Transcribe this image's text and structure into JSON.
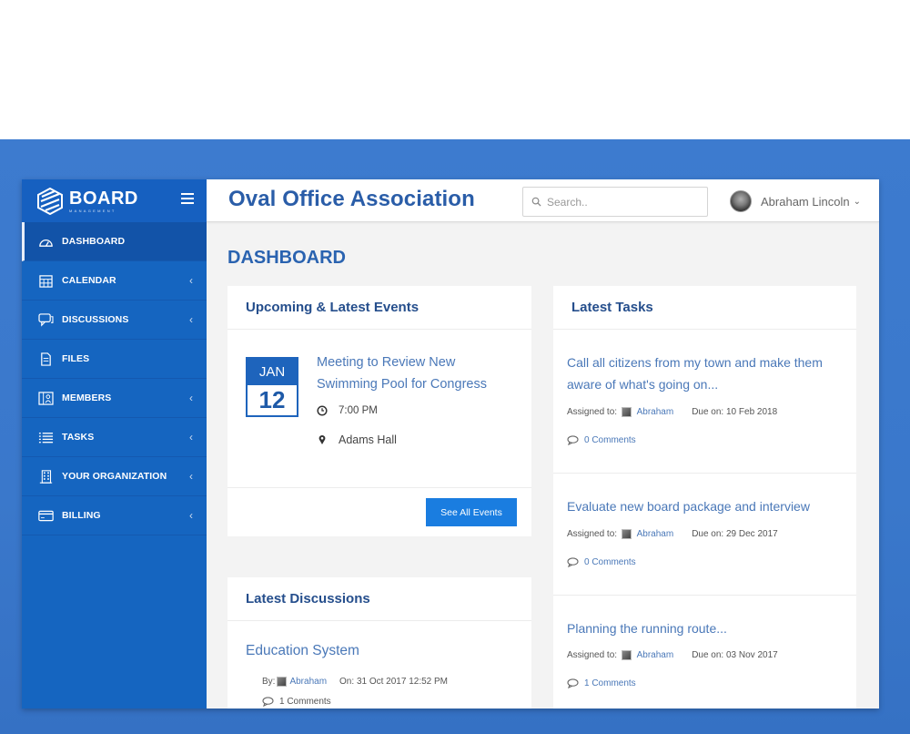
{
  "brand": {
    "name": "BOARD",
    "subtitle": "MANAGEMENT"
  },
  "sidebar": {
    "items": [
      {
        "label": "DASHBOARD",
        "icon": "dashboard-gauge-icon",
        "active": true,
        "has_submenu": false
      },
      {
        "label": "CALENDAR",
        "icon": "calendar-icon",
        "active": false,
        "has_submenu": true
      },
      {
        "label": "DISCUSSIONS",
        "icon": "chat-bubbles-icon",
        "active": false,
        "has_submenu": true
      },
      {
        "label": "FILES",
        "icon": "file-icon",
        "active": false,
        "has_submenu": false
      },
      {
        "label": "MEMBERS",
        "icon": "members-icon",
        "active": false,
        "has_submenu": true
      },
      {
        "label": "TASKS",
        "icon": "list-icon",
        "active": false,
        "has_submenu": true
      },
      {
        "label": "YOUR ORGANIZATION",
        "icon": "building-icon",
        "active": false,
        "has_submenu": true
      },
      {
        "label": "BILLING",
        "icon": "credit-card-icon",
        "active": false,
        "has_submenu": true
      }
    ],
    "chevron": "‹"
  },
  "header": {
    "org_title": "Oval Office Association",
    "search_placeholder": "Search..",
    "user_name": "Abraham Lincoln",
    "user_chevron": "⌄"
  },
  "page": {
    "title": "DASHBOARD"
  },
  "events": {
    "title": "Upcoming & Latest Events",
    "items": [
      {
        "month": "JAN",
        "day": "12",
        "title": "Meeting to Review New Swimming Pool for Congress",
        "time": "7:00 PM",
        "location": "Adams Hall"
      }
    ],
    "see_all_label": "See All Events"
  },
  "discussions": {
    "title": "Latest Discussions",
    "items": [
      {
        "title": "Education System",
        "by_label": "By:",
        "author": "Abraham",
        "on_label": "On:",
        "date": "31 Oct 2017 12:52 PM",
        "comments": "1 Comments"
      }
    ]
  },
  "tasks": {
    "title": "Latest Tasks",
    "assigned_label": "Assigned to:",
    "due_label": "Due on:",
    "items": [
      {
        "title": "Call all citizens from my town and make them aware of what's going on...",
        "assignee": "Abraham",
        "due": "10 Feb 2018",
        "comments": "0 Comments"
      },
      {
        "title": "Evaluate new board package and interview",
        "assignee": "Abraham",
        "due": "29 Dec 2017",
        "comments": "0 Comments"
      },
      {
        "title": "Planning the running route...",
        "assignee": "Abraham",
        "due": "03 Nov 2017",
        "comments": "1 Comments"
      }
    ]
  },
  "colors": {
    "sidebar": "#1565c0",
    "accent": "#1a7de0",
    "title_blue": "#2a5da8",
    "link_blue": "#4a78b8",
    "backdrop": "#3d7bcf"
  }
}
